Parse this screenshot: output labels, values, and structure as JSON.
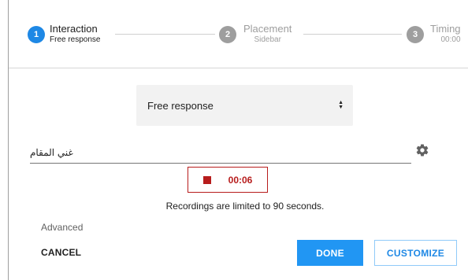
{
  "stepper": {
    "steps": [
      {
        "number": "1",
        "title": "Interaction",
        "subtitle": "Free response",
        "state": "active"
      },
      {
        "number": "2",
        "title": "Placement",
        "subtitle": "Sidebar",
        "state": "inactive"
      },
      {
        "number": "3",
        "title": "Timing",
        "subtitle": "00:00",
        "state": "inactive"
      }
    ]
  },
  "interaction_type": {
    "selected": "Free response",
    "arrow_icon": "sort-arrows-icon"
  },
  "question_input": {
    "value": "غني المقام"
  },
  "settings": {
    "icon": "gear-icon"
  },
  "recording": {
    "time": "00:06",
    "stop_icon": "stop-icon",
    "limit_note": "Recordings are limited to 90 seconds."
  },
  "footer": {
    "advanced_label": "Advanced",
    "cancel_label": "CANCEL",
    "done_label": "DONE",
    "customize_label": "CUSTOMIZE"
  },
  "colors": {
    "accent": "#2196f3",
    "active_step": "#1e88e5",
    "inactive_step": "#9e9e9e",
    "recording": "#b71c1c"
  }
}
